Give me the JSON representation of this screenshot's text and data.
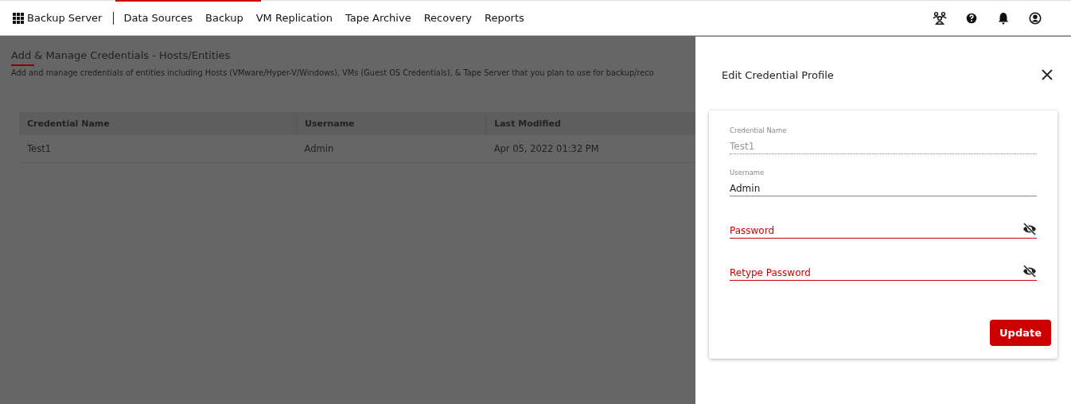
{
  "navbar": {
    "brand": "Backup Server",
    "items": [
      {
        "label": "Data Sources"
      },
      {
        "label": "Backup"
      },
      {
        "label": "VM Replication"
      },
      {
        "label": "Tape Archive"
      },
      {
        "label": "Recovery"
      },
      {
        "label": "Reports"
      }
    ]
  },
  "page": {
    "title": "Add & Manage Credentials - Hosts/Entities",
    "description": "Add and manage credentials of entities including Hosts (VMware/Hyper-V/Windows), VMs (Guest OS Credentials), & Tape Server that you plan to use for backup/reco"
  },
  "table": {
    "columns": [
      "Credential Name",
      "Username",
      "Last Modified"
    ],
    "rows": [
      [
        "Test1",
        "Admin",
        "Apr 05, 2022 01:32 PM"
      ]
    ]
  },
  "panel": {
    "title": "Edit Credential Profile",
    "fields": [
      {
        "kind": "readonly",
        "label": "Credential Name",
        "value": "Test1",
        "invalid": false
      },
      {
        "kind": "text",
        "label": "Username",
        "value": "Admin",
        "invalid": false
      },
      {
        "kind": "password",
        "placeholder": "Password",
        "invalid": true
      },
      {
        "kind": "password",
        "placeholder": "Retype Password",
        "invalid": true
      }
    ],
    "button": "Update"
  }
}
